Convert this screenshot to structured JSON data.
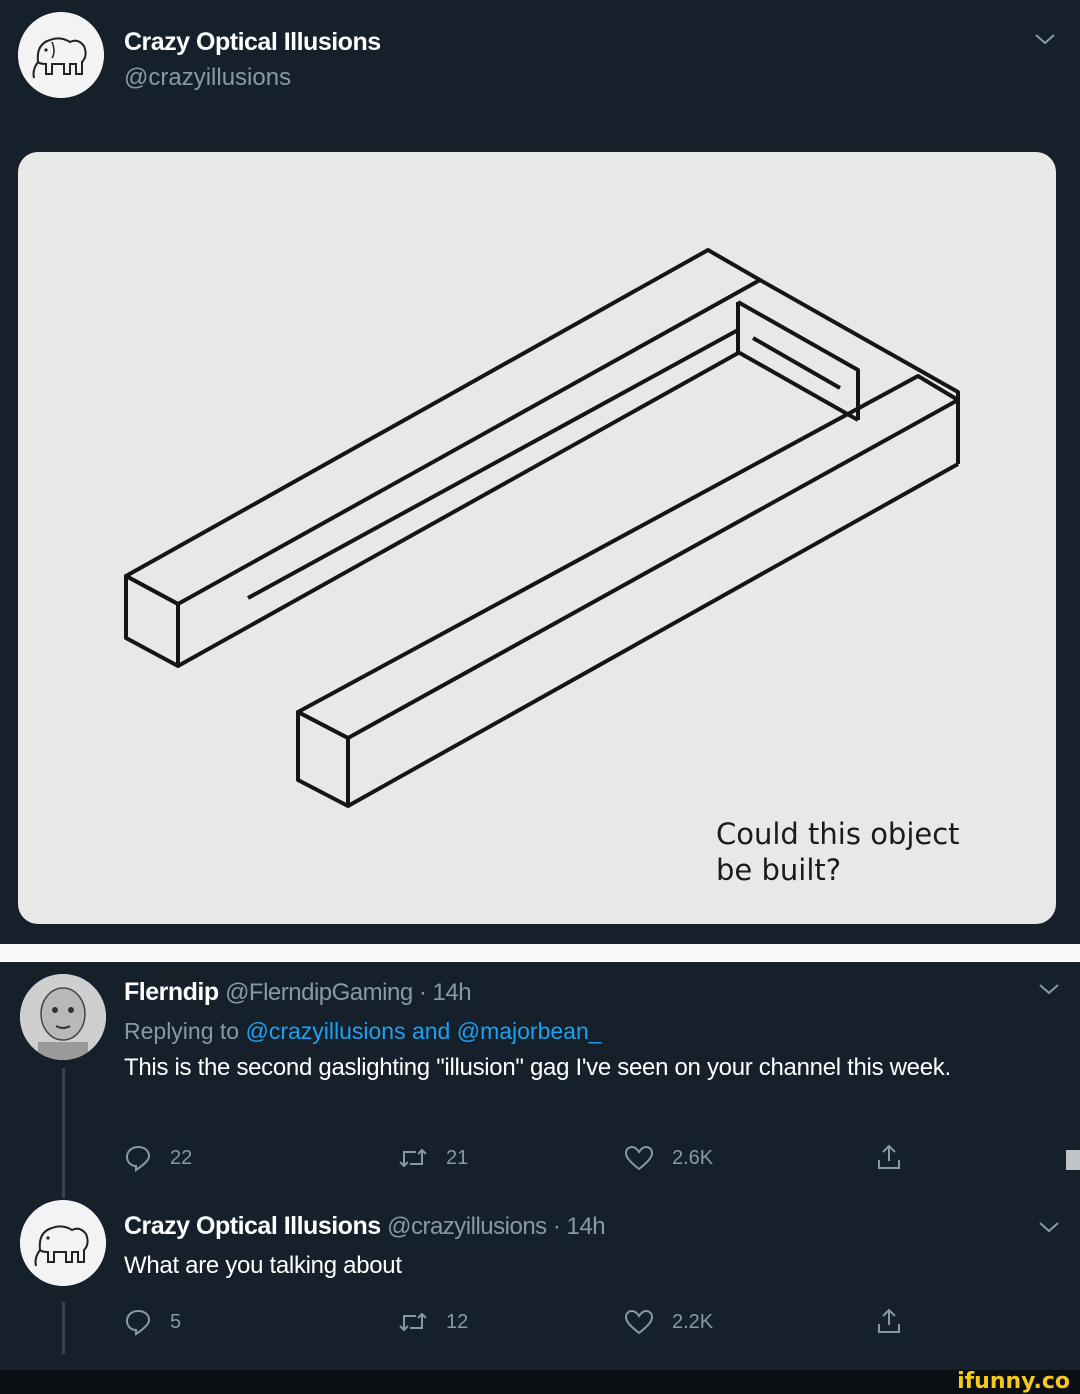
{
  "tweet": {
    "author_name": "Crazy Optical Illusions",
    "author_handle": "@crazyillusions",
    "image_caption_line1": "Could this object",
    "image_caption_line2": "be built?"
  },
  "replies": [
    {
      "name": "Flerndip",
      "handle_time": "@FlerndipGaming · 14h",
      "replying_prefix": "Replying to ",
      "replying_link": "@crazyillusions and @majorbean_",
      "text": "This is the second gaslighting \"illusion\" gag I've seen on your channel this week.",
      "reply_count": "22",
      "retweet_count": "21",
      "like_count": "2.6K"
    },
    {
      "name": "Crazy Optical Illusions",
      "handle_time": "@crazyillusions · 14h",
      "text": "What are you talking about",
      "reply_count": "5",
      "retweet_count": "12",
      "like_count": "2.2K"
    }
  ],
  "watermark": "ifunny.co",
  "colors": {
    "background": "#15202b",
    "muted": "#8899a6",
    "link": "#1da1f2",
    "divider": "#fafafa"
  }
}
